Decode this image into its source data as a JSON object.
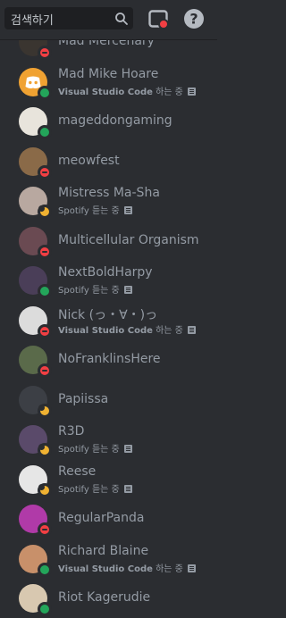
{
  "search": {
    "placeholder": "검색하기"
  },
  "activity": {
    "vscode_app": "Visual Studio Code",
    "vscode_suffix": " 하는 중",
    "spotify": "Spotify 듣는 중"
  },
  "members": [
    {
      "name": "Mad Mercenary",
      "status": "dnd",
      "activity": "",
      "avatar_color": "#3a3530"
    },
    {
      "name": "Mad Mike Hoare",
      "status": "online",
      "activity": "vscode",
      "avatar_color": "#f0a232"
    },
    {
      "name": "mageddongaming",
      "status": "online",
      "activity": "",
      "avatar_color": "#e8e4dc"
    },
    {
      "name": "meowfest",
      "status": "dnd",
      "activity": "",
      "avatar_color": "#8a6a48"
    },
    {
      "name": "Mistress Ma-Sha",
      "status": "idle",
      "activity": "spotify",
      "avatar_color": "#b8a8a0"
    },
    {
      "name": "Multicellular Organism",
      "status": "dnd",
      "activity": "",
      "avatar_color": "#6a4a52"
    },
    {
      "name": "NextBoldHarpy",
      "status": "online",
      "activity": "spotify",
      "avatar_color": "#4a3e58"
    },
    {
      "name": "Nick (っ・∀・)っ",
      "status": "dnd",
      "activity": "vscode",
      "avatar_color": "#dcdcdc"
    },
    {
      "name": "NoFranklinsHere",
      "status": "dnd",
      "activity": "",
      "avatar_color": "#5a6a4a"
    },
    {
      "name": "Papiissa",
      "status": "idle",
      "activity": "",
      "avatar_color": "#3c3f45"
    },
    {
      "name": "R3D",
      "status": "idle",
      "activity": "spotify",
      "avatar_color": "#5a4a6a"
    },
    {
      "name": "Reese",
      "status": "idle",
      "activity": "spotify",
      "avatar_color": "#e6e6e6"
    },
    {
      "name": "RegularPanda",
      "status": "dnd",
      "activity": "",
      "avatar_color": "#b03aa8"
    },
    {
      "name": "Richard Blaine",
      "status": "online",
      "activity": "vscode",
      "avatar_color": "#c8906a"
    },
    {
      "name": "Riot Kagerudie",
      "status": "online",
      "activity": "",
      "avatar_color": "#d8c8b0"
    }
  ]
}
